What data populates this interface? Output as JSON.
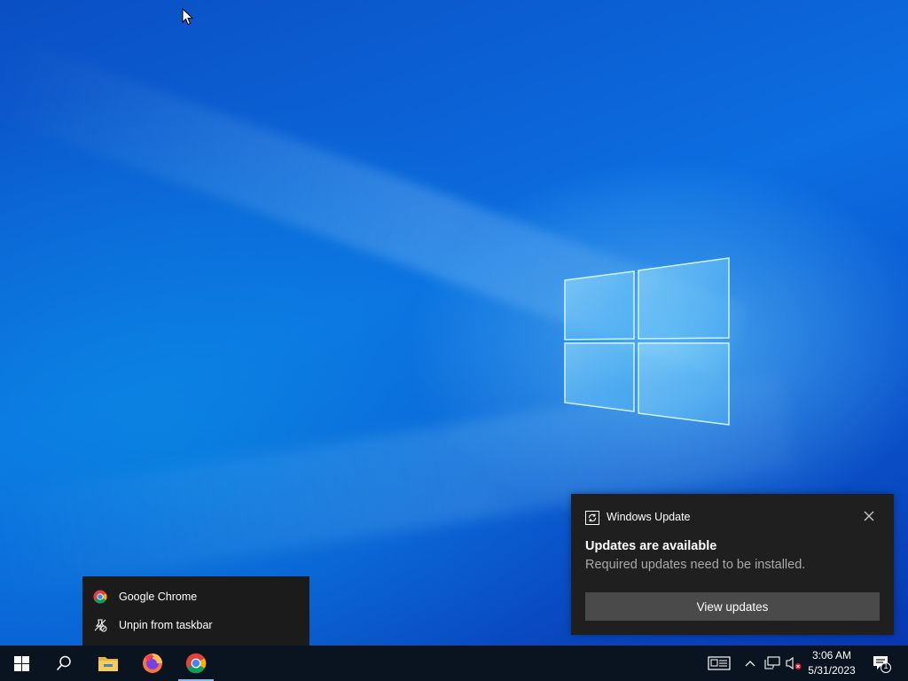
{
  "desktop": {
    "wallpaper": "windows-10-hero",
    "accent": "#0b5fd3"
  },
  "jumplist": {
    "items": [
      {
        "label": "Google Chrome",
        "icon": "chrome-icon"
      },
      {
        "label": "Unpin from taskbar",
        "icon": "unpin-icon"
      }
    ]
  },
  "toast": {
    "app_name": "Windows Update",
    "title": "Updates are available",
    "body": "Required updates need to be installed.",
    "button_label": "View updates"
  },
  "taskbar": {
    "pinned": [
      {
        "name": "start",
        "icon": "windows-icon"
      },
      {
        "name": "search",
        "icon": "search-icon"
      },
      {
        "name": "file-explorer",
        "icon": "folder-icon"
      },
      {
        "name": "firefox",
        "icon": "firefox-icon"
      },
      {
        "name": "chrome",
        "icon": "chrome-icon",
        "active": true
      }
    ],
    "tray": {
      "time": "3:06 AM",
      "date": "5/31/2023",
      "notification_count": "1"
    }
  }
}
